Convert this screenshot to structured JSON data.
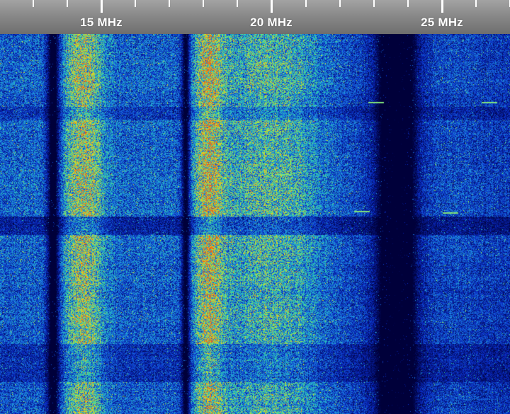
{
  "scale": {
    "unit": "MHz",
    "labels": [
      {
        "freq": 15,
        "text": "15 MHz"
      },
      {
        "freq": 20,
        "text": "20 MHz"
      },
      {
        "freq": 25,
        "text": "25 MHz"
      }
    ],
    "minor_step_mhz": 1
  },
  "waterfall": {
    "colormap": [
      "#00003a",
      "#0a2cc8",
      "#1f8fe0",
      "#2fd4a8",
      "#b9e23a",
      "#f2c51a",
      "#f05a14"
    ],
    "background": "#00001a"
  }
}
